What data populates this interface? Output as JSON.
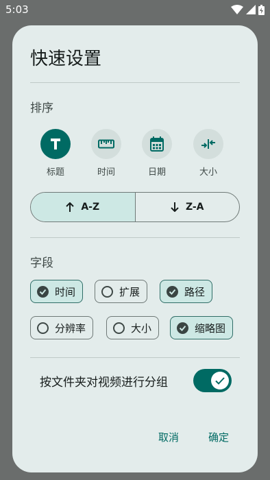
{
  "status_bar": {
    "time": "5:03"
  },
  "dialog": {
    "title": "快速设置",
    "sort_section": {
      "label": "排序",
      "options": [
        {
          "label": "标题",
          "icon": "text-t-icon",
          "selected": true
        },
        {
          "label": "时间",
          "icon": "ruler-icon",
          "selected": false
        },
        {
          "label": "日期",
          "icon": "calendar-icon",
          "selected": false
        },
        {
          "label": "大小",
          "icon": "compress-icon",
          "selected": false
        }
      ],
      "direction": [
        {
          "label": "A-Z",
          "icon": "arrow-up-icon",
          "selected": true
        },
        {
          "label": "Z-A",
          "icon": "arrow-down-icon",
          "selected": false
        }
      ]
    },
    "fields_section": {
      "label": "字段",
      "chips": [
        {
          "label": "时间",
          "checked": true
        },
        {
          "label": "扩展",
          "checked": false
        },
        {
          "label": "路径",
          "checked": true
        },
        {
          "label": "分辨率",
          "checked": false
        },
        {
          "label": "大小",
          "checked": false
        },
        {
          "label": "缩略图",
          "checked": true
        }
      ]
    },
    "group_toggle": {
      "label": "按文件夹对视频进行分组",
      "on": true
    },
    "actions": {
      "cancel": "取消",
      "confirm": "确定"
    }
  },
  "colors": {
    "accent": "#006a63",
    "dialog_bg": "#e3eceb",
    "chip_selected": "#cde8e4"
  }
}
